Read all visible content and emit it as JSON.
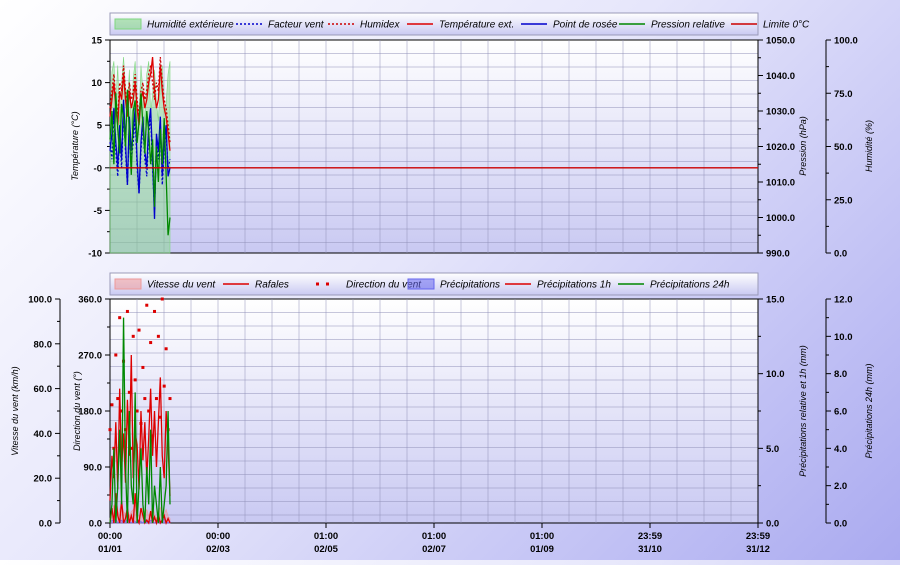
{
  "chart_data": [
    {
      "type": "line",
      "legend_position": "top",
      "grid": true,
      "x_tick_labels": [],
      "axes": {
        "left": {
          "label": "Température (°C)",
          "ylim": [
            -10,
            15
          ],
          "ticks": [
            "15",
            "10",
            "5",
            "-0",
            "-5",
            "-10"
          ]
        },
        "right": {
          "label": "Pression (hPa)",
          "ylim": [
            990,
            1050
          ],
          "ticks": [
            "1050.0",
            "1040.0",
            "1030.0",
            "1020.0",
            "1010.0",
            "1000.0",
            "990.0"
          ]
        },
        "far_right": {
          "label": "Humidité (%)",
          "ylim": [
            0,
            100
          ],
          "ticks": [
            "100.0",
            "75.0",
            "50.0",
            "25.0",
            "0.0"
          ]
        }
      },
      "x_end": 62,
      "series": [
        {
          "name": "Humidité extérieure",
          "axis": "far_right",
          "style": "area",
          "color": "#7fd77f",
          "x": [
            0,
            2,
            4,
            6,
            8,
            10,
            12,
            14,
            16,
            18,
            20,
            22,
            24,
            26,
            28,
            30,
            32,
            34,
            36,
            38,
            40,
            42,
            44,
            46,
            48,
            50,
            52,
            54,
            56,
            58,
            60,
            62
          ],
          "values": [
            55,
            85,
            90,
            70,
            88,
            60,
            80,
            92,
            78,
            68,
            86,
            58,
            82,
            90,
            72,
            64,
            88,
            76,
            60,
            84,
            90,
            66,
            74,
            86,
            70,
            62,
            80,
            88,
            66,
            70,
            84,
            90
          ]
        },
        {
          "name": "Facteur vent",
          "axis": "left",
          "style": "dotted",
          "color": "#0000cc",
          "x": [
            0,
            2,
            4,
            6,
            8,
            10,
            12,
            14,
            16,
            18,
            20,
            22,
            24,
            26,
            28,
            30,
            32,
            34,
            36,
            38,
            40,
            42,
            44,
            46,
            48,
            50,
            52,
            54,
            56,
            58,
            60,
            62
          ],
          "values": [
            3,
            1,
            6,
            2,
            -1,
            4,
            0,
            7,
            2,
            -2,
            5,
            1,
            3,
            6,
            0,
            -3,
            2,
            5,
            1,
            -1,
            4,
            6,
            0,
            -5,
            3,
            1,
            5,
            -2,
            2,
            4,
            0,
            1
          ]
        },
        {
          "name": "Humidex",
          "axis": "left",
          "style": "dotted",
          "color": "#cc0000",
          "x": [
            0,
            2,
            4,
            6,
            8,
            10,
            12,
            14,
            16,
            18,
            20,
            22,
            24,
            26,
            28,
            30,
            32,
            34,
            36,
            38,
            40,
            42,
            44,
            46,
            48,
            50,
            52,
            54,
            56,
            58,
            60,
            62
          ],
          "values": [
            7,
            9,
            11,
            8,
            6,
            10,
            9,
            12,
            9,
            7,
            10,
            8,
            9,
            11,
            8,
            6,
            9,
            10,
            8,
            9,
            11,
            12,
            10,
            8,
            10,
            9,
            13,
            10,
            8,
            7,
            5,
            3
          ]
        },
        {
          "name": "Température ext.",
          "axis": "left",
          "style": "line",
          "color": "#dd0000",
          "x": [
            0,
            2,
            4,
            6,
            8,
            10,
            12,
            14,
            16,
            18,
            20,
            22,
            24,
            26,
            28,
            30,
            32,
            34,
            36,
            38,
            40,
            42,
            44,
            46,
            48,
            50,
            52,
            54,
            56,
            58,
            60,
            62
          ],
          "values": [
            6,
            8,
            10,
            7,
            5,
            9,
            8,
            11,
            8,
            6,
            9,
            7,
            8,
            10,
            7,
            5,
            8,
            9,
            7,
            8,
            10,
            11,
            13,
            9,
            7,
            8,
            12,
            9,
            7,
            6,
            4,
            2
          ]
        },
        {
          "name": "Point de rosée",
          "axis": "left",
          "style": "line",
          "color": "#0000cc",
          "x": [
            0,
            2,
            4,
            6,
            8,
            10,
            12,
            14,
            16,
            18,
            20,
            22,
            24,
            26,
            28,
            30,
            32,
            34,
            36,
            38,
            40,
            42,
            44,
            46,
            48,
            50,
            52,
            54,
            56,
            58,
            60,
            62
          ],
          "values": [
            2,
            4,
            7,
            3,
            0,
            5,
            1,
            8,
            3,
            -2,
            6,
            2,
            4,
            7,
            1,
            -3,
            3,
            6,
            2,
            0,
            5,
            7,
            1,
            -6,
            4,
            2,
            6,
            -1,
            3,
            5,
            -1,
            0
          ]
        },
        {
          "name": "Pression relative",
          "axis": "right",
          "style": "line",
          "color": "#008800",
          "x": [
            0,
            2,
            4,
            6,
            8,
            10,
            12,
            14,
            16,
            18,
            20,
            22,
            24,
            26,
            28,
            30,
            32,
            34,
            36,
            38,
            40,
            42,
            44,
            46,
            48,
            50,
            52,
            54,
            56,
            58,
            60,
            62
          ],
          "values": [
            1022,
            1030,
            1015,
            1035,
            1025,
            1018,
            1032,
            1028,
            1020,
            1036,
            1024,
            1012,
            1030,
            1033,
            1021,
            1027,
            1035,
            1026,
            1018,
            1030,
            1024,
            1015,
            1022,
            1003,
            1020,
            1010,
            1025,
            1015,
            1028,
            1012,
            995,
            1000
          ]
        },
        {
          "name": "Limite 0°C",
          "axis": "left",
          "style": "line",
          "color": "#cc0000",
          "x": [
            0,
            360
          ],
          "values": [
            0,
            0
          ]
        }
      ]
    },
    {
      "type": "line",
      "legend_position": "top",
      "grid": true,
      "x_tick_labels": [
        [
          "00:00",
          "01/01"
        ],
        [
          "00:00",
          "02/03"
        ],
        [
          "01:00",
          "02/05"
        ],
        [
          "01:00",
          "02/07"
        ],
        [
          "01:00",
          "01/09"
        ],
        [
          "23:59",
          "31/10"
        ],
        [
          "23:59",
          "31/12"
        ]
      ],
      "axes": {
        "left": {
          "label": "Vitesse du vent (km/h)",
          "ylim": [
            0,
            100
          ],
          "ticks": [
            "100.0",
            "80.0",
            "60.0",
            "40.0",
            "20.0",
            "0.0"
          ]
        },
        "left2": {
          "label": "Direction du vent (°)",
          "ylim": [
            0,
            360
          ],
          "ticks": [
            "360.0",
            "270.0",
            "180.0",
            "90.0",
            "0.0"
          ]
        },
        "right": {
          "label": "Précipitations relative et 1h (mm)",
          "ylim": [
            0,
            15
          ],
          "ticks": [
            "15.0",
            "10.0",
            "5.0",
            "0.0"
          ]
        },
        "far_right": {
          "label": "Précipitations 24h (mm)",
          "ylim": [
            0,
            12
          ],
          "ticks": [
            "12.0",
            "10.0",
            "8.0",
            "6.0",
            "4.0",
            "2.0",
            "0.0"
          ]
        }
      },
      "x_end": 62,
      "series": [
        {
          "name": "Vitesse du vent",
          "axis": "left",
          "style": "area",
          "color": "#ee9999",
          "x": [
            0,
            2,
            4,
            6,
            8,
            10,
            12,
            14,
            16,
            18,
            20,
            22,
            24,
            26,
            28,
            30,
            32,
            34,
            36,
            38,
            40,
            42,
            44,
            46,
            48,
            50,
            52,
            54,
            56,
            58,
            60,
            62
          ],
          "values": [
            2,
            5,
            8,
            4,
            3,
            6,
            9,
            5,
            4,
            7,
            3,
            5,
            6,
            8,
            4,
            3,
            5,
            7,
            4,
            6,
            3,
            5,
            8,
            4,
            2,
            5,
            7,
            3,
            4,
            6,
            3,
            2
          ]
        },
        {
          "name": "Rafales",
          "axis": "left",
          "style": "line",
          "color": "#dd0000",
          "x": [
            0,
            2,
            4,
            6,
            8,
            10,
            12,
            14,
            16,
            18,
            20,
            22,
            24,
            26,
            28,
            30,
            32,
            34,
            36,
            38,
            40,
            42,
            44,
            46,
            48,
            50,
            52,
            54,
            56,
            58,
            60,
            62
          ],
          "values": [
            10,
            30,
            20,
            45,
            15,
            60,
            25,
            40,
            18,
            55,
            30,
            75,
            20,
            40,
            35,
            15,
            50,
            28,
            45,
            20,
            38,
            60,
            30,
            50,
            25,
            45,
            65,
            30,
            20,
            50,
            35,
            12
          ]
        },
        {
          "name": "Direction du vent",
          "axis": "left2",
          "style": "dots",
          "color": "#dd0000",
          "x": [
            0,
            2,
            4,
            6,
            8,
            10,
            12,
            14,
            16,
            18,
            20,
            22,
            24,
            26,
            28,
            30,
            32,
            34,
            36,
            38,
            40,
            42,
            44,
            46,
            48,
            50,
            52,
            54,
            56,
            58,
            60,
            62
          ],
          "values": [
            150,
            190,
            120,
            270,
            200,
            330,
            180,
            260,
            150,
            340,
            210,
            120,
            300,
            230,
            180,
            310,
            160,
            250,
            200,
            350,
            180,
            290,
            140,
            340,
            200,
            300,
            170,
            360,
            220,
            280,
            150,
            200
          ]
        },
        {
          "name": "Précipitations",
          "axis": "right",
          "style": "area",
          "color": "#6666ee",
          "x": [
            0,
            2,
            4,
            6,
            8,
            10,
            12,
            14,
            16,
            18,
            20,
            22,
            24,
            26,
            28,
            30,
            32,
            34,
            36,
            38,
            40,
            42,
            44,
            46,
            48,
            50,
            52,
            54,
            56,
            58,
            60,
            62
          ],
          "values": [
            0,
            0.2,
            0.1,
            0.3,
            0,
            0.1,
            0.2,
            0,
            0.1,
            0.3,
            0.1,
            0,
            0.2,
            0.1,
            0,
            0.2,
            0.1,
            0,
            0.3,
            0.1,
            0,
            0.2,
            0.1,
            0,
            0.1,
            0.2,
            0,
            0.1,
            0.3,
            0.1,
            0,
            0.1
          ]
        },
        {
          "name": "Précipitations 1h",
          "axis": "right",
          "style": "line",
          "color": "#dd0000",
          "x": [
            0,
            2,
            4,
            6,
            8,
            10,
            12,
            14,
            16,
            18,
            20,
            22,
            24,
            26,
            28,
            30,
            32,
            34,
            36,
            38,
            40,
            42,
            44,
            46,
            48,
            50,
            52,
            54,
            56,
            58,
            60,
            62
          ],
          "values": [
            0,
            1,
            0,
            2,
            0.5,
            0,
            1.5,
            0,
            0.3,
            1,
            0,
            0.5,
            0,
            2,
            0.3,
            0,
            1,
            0.5,
            0,
            0.2,
            0,
            0.8,
            0,
            0.4,
            0,
            0.6,
            0,
            0.2,
            0.5,
            0,
            0.3,
            0
          ]
        },
        {
          "name": "Précipitations 24h",
          "axis": "far_right",
          "style": "line",
          "color": "#008800",
          "x": [
            0,
            2,
            4,
            6,
            8,
            10,
            12,
            14,
            16,
            18,
            20,
            22,
            24,
            26,
            28,
            30,
            32,
            34,
            36,
            38,
            40,
            42,
            44,
            46,
            48,
            50,
            52,
            54,
            56,
            58,
            60,
            62
          ],
          "values": [
            0,
            1,
            4,
            0,
            2,
            5,
            1,
            11,
            3,
            0,
            6,
            2,
            1,
            7,
            0,
            2,
            4,
            1,
            0,
            3,
            1,
            5,
            0,
            2,
            1,
            0,
            3,
            0,
            1,
            2,
            6,
            1
          ]
        }
      ]
    }
  ],
  "colors": {
    "grid": "#9090b8",
    "plot_top": "#ffffff",
    "plot_bottom": "#c9c9f2",
    "axis": "#000000"
  }
}
